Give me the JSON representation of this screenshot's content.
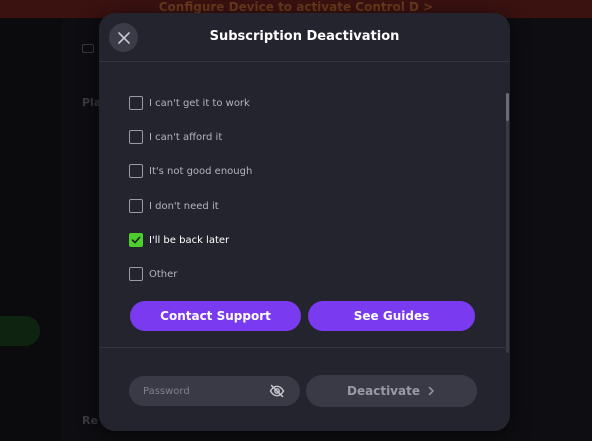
{
  "background": {
    "banner_text": "Configure Device to activate Control D >",
    "label_plan": "Pla",
    "label_re": "Re"
  },
  "modal": {
    "title": "Subscription Deactivation",
    "options": [
      {
        "label": "I can't get it to work",
        "checked": false
      },
      {
        "label": "I can't afford it",
        "checked": false
      },
      {
        "label": "It's not good enough",
        "checked": false
      },
      {
        "label": "I don't need it",
        "checked": false
      },
      {
        "label": "I'll be back later",
        "checked": true
      },
      {
        "label": "Other",
        "checked": false
      }
    ],
    "contact_support_label": "Contact Support",
    "see_guides_label": "See Guides",
    "password": {
      "placeholder": "Password",
      "value": ""
    },
    "deactivate_label": "Deactivate"
  },
  "colors": {
    "accent_purple": "#7a3bf0",
    "check_green": "#4ccf2a",
    "modal_bg": "#24242f"
  },
  "icons": {
    "close": "close-icon",
    "eye_slash": "eye-slash-icon",
    "chevron": "chevron-right-icon",
    "check": "check-icon"
  }
}
